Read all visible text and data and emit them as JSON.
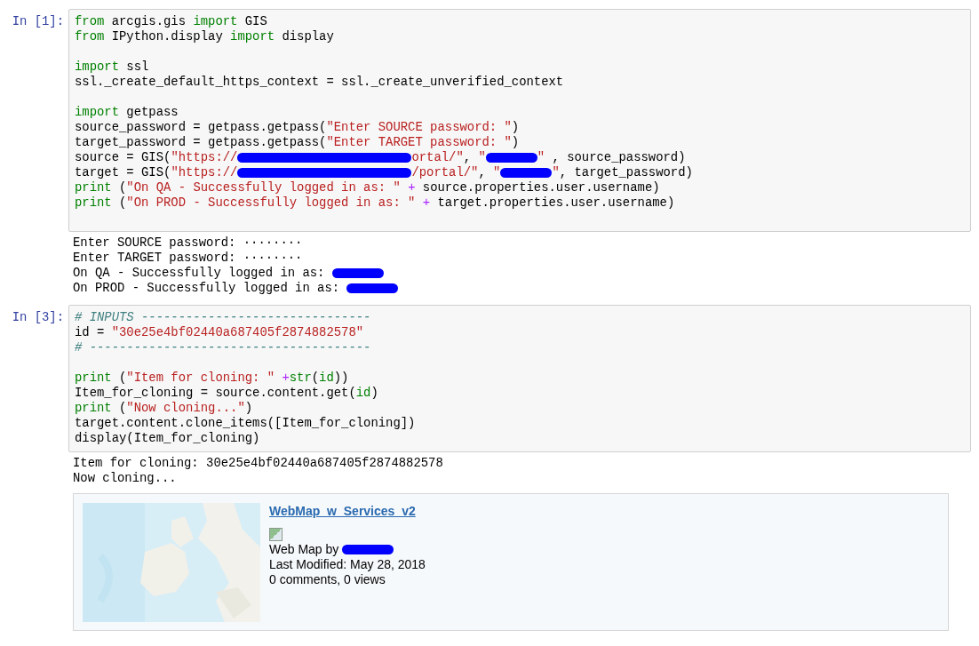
{
  "cells": [
    {
      "prompt": "In [1]:",
      "input": [
        [
          [
            {
              "kind": "kw",
              "text": "from"
            },
            {
              "kind": "plain",
              "text": " arcgis.gis "
            },
            {
              "kind": "kw",
              "text": "import"
            },
            {
              "kind": "plain",
              "text": " GIS"
            }
          ],
          [
            {
              "kind": "kw",
              "text": "from"
            },
            {
              "kind": "plain",
              "text": " IPython.display "
            },
            {
              "kind": "kw",
              "text": "import"
            },
            {
              "kind": "plain",
              "text": " display"
            }
          ]
        ],
        [
          [
            {
              "kind": "kw",
              "text": "import"
            },
            {
              "kind": "plain",
              "text": " ssl"
            }
          ],
          [
            {
              "kind": "plain",
              "text": "ssl._create_default_https_context = ssl._create_unverified_context"
            }
          ]
        ],
        [
          [
            {
              "kind": "kw",
              "text": "import"
            },
            {
              "kind": "plain",
              "text": " getpass"
            }
          ],
          [
            {
              "kind": "plain",
              "text": "source_password = getpass.getpass("
            },
            {
              "kind": "str",
              "text": "\"Enter SOURCE password: \""
            },
            {
              "kind": "plain",
              "text": ")"
            }
          ],
          [
            {
              "kind": "plain",
              "text": "target_password = getpass.getpass("
            },
            {
              "kind": "str",
              "text": "\"Enter TARGET password: \""
            },
            {
              "kind": "plain",
              "text": ")"
            }
          ],
          [
            {
              "kind": "plain",
              "text": "source = GIS("
            },
            {
              "kind": "str",
              "text": "\"https://"
            },
            {
              "kind": "longredaction"
            },
            {
              "kind": "str",
              "text": "ortal/\""
            },
            {
              "kind": "plain",
              "text": ", "
            },
            {
              "kind": "str",
              "text": "\""
            },
            {
              "kind": "redaction"
            },
            {
              "kind": "str",
              "text": "\""
            },
            {
              "kind": "plain",
              "text": " , source_password)"
            }
          ],
          [
            {
              "kind": "plain",
              "text": "target = GIS("
            },
            {
              "kind": "str",
              "text": "\"https://"
            },
            {
              "kind": "longredaction"
            },
            {
              "kind": "str",
              "text": "/portal/\""
            },
            {
              "kind": "plain",
              "text": ", "
            },
            {
              "kind": "str",
              "text": "\""
            },
            {
              "kind": "redaction"
            },
            {
              "kind": "str",
              "text": "\""
            },
            {
              "kind": "plain",
              "text": ", target_password)"
            }
          ],
          [
            {
              "kind": "kw",
              "text": "print"
            },
            {
              "kind": "plain",
              "text": " ("
            },
            {
              "kind": "str",
              "text": "\"On QA - Successfully logged in as: \""
            },
            {
              "kind": "op",
              "text": " +"
            },
            {
              "kind": "plain",
              "text": " source.properties.user.username)"
            }
          ],
          [
            {
              "kind": "kw",
              "text": "print"
            },
            {
              "kind": "plain",
              "text": " ("
            },
            {
              "kind": "str",
              "text": "\"On PROD - Successfully logged in as: \""
            },
            {
              "kind": "op",
              "text": " +"
            },
            {
              "kind": "plain",
              "text": " target.properties.user.username)"
            }
          ]
        ]
      ],
      "output": [
        [
          {
            "kind": "plain",
            "text": "Enter SOURCE password: ········"
          }
        ],
        [
          {
            "kind": "plain",
            "text": "Enter TARGET password: ········"
          }
        ],
        [
          {
            "kind": "plain",
            "text": "On QA - Successfully logged in as: "
          },
          {
            "kind": "redaction"
          }
        ],
        [
          {
            "kind": "plain",
            "text": "On PROD - Successfully logged in as: "
          },
          {
            "kind": "redaction"
          }
        ]
      ]
    },
    {
      "prompt": "In [3]:",
      "input": [
        [
          [
            {
              "kind": "comment",
              "text": "# INPUTS -------------------------------"
            }
          ],
          [
            {
              "kind": "plain",
              "text": "id = "
            },
            {
              "kind": "str",
              "text": "\"30e25e4bf02440a687405f2874882578\""
            }
          ],
          [
            {
              "kind": "comment",
              "text": "# --------------------------------------"
            }
          ]
        ],
        [
          [
            {
              "kind": "kw",
              "text": "print"
            },
            {
              "kind": "plain",
              "text": " ("
            },
            {
              "kind": "str",
              "text": "\"Item for cloning: \""
            },
            {
              "kind": "op",
              "text": " +"
            },
            {
              "kind": "kw",
              "text": "str"
            },
            {
              "kind": "plain",
              "text": "("
            },
            {
              "kind": "kw",
              "text": "id"
            },
            {
              "kind": "plain",
              "text": "))"
            }
          ],
          [
            {
              "kind": "plain",
              "text": "Item_for_cloning = source.content.get("
            },
            {
              "kind": "kw",
              "text": "id"
            },
            {
              "kind": "plain",
              "text": ")"
            }
          ],
          [
            {
              "kind": "kw",
              "text": "print"
            },
            {
              "kind": "plain",
              "text": " ("
            },
            {
              "kind": "str",
              "text": "\"Now cloning...\""
            },
            {
              "kind": "plain",
              "text": ")"
            }
          ],
          [
            {
              "kind": "plain",
              "text": "target.content.clone_items([Item_for_cloning])"
            }
          ],
          [
            {
              "kind": "plain",
              "text": "display(Item_for_cloning)"
            }
          ]
        ]
      ],
      "output": [
        [
          {
            "kind": "plain",
            "text": "Item for cloning: 30e25e4bf02440a687405f2874882578"
          }
        ],
        [
          {
            "kind": "plain",
            "text": "Now cloning..."
          }
        ]
      ],
      "item_card": {
        "title": "WebMap_w_Services_v2",
        "type_line": "Web Map by ",
        "owner": {
          "kind": "redaction"
        },
        "modified": "Last Modified: May 28, 2018",
        "stats": "0 comments, 0 views"
      }
    }
  ]
}
